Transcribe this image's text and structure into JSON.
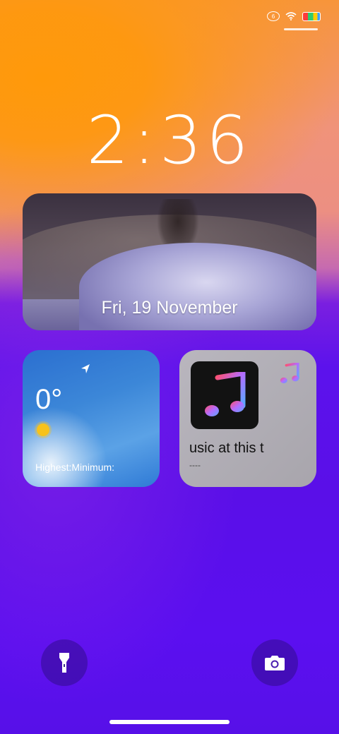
{
  "status_bar": {
    "signal_icon": "data-signal-icon",
    "network_label": "6",
    "wifi_icon": "wifi-icon",
    "battery_icon": "battery-icon"
  },
  "lockscreen": {
    "time": "2:36",
    "date": "Fri, 19 November"
  },
  "weather": {
    "location_icon": "location-arrow-icon",
    "temperature": "0°",
    "condition_icon": "sun-icon",
    "high_low": "Highest:Minimum:"
  },
  "music": {
    "app_icon": "apple-music-icon",
    "song": "usic at this t",
    "artist": "----"
  },
  "quick_actions": {
    "flashlight_icon": "flashlight-icon",
    "camera_icon": "camera-icon"
  },
  "colors": {
    "top_orange": "#ff990a",
    "bottom_purple": "#5a0fe8"
  }
}
